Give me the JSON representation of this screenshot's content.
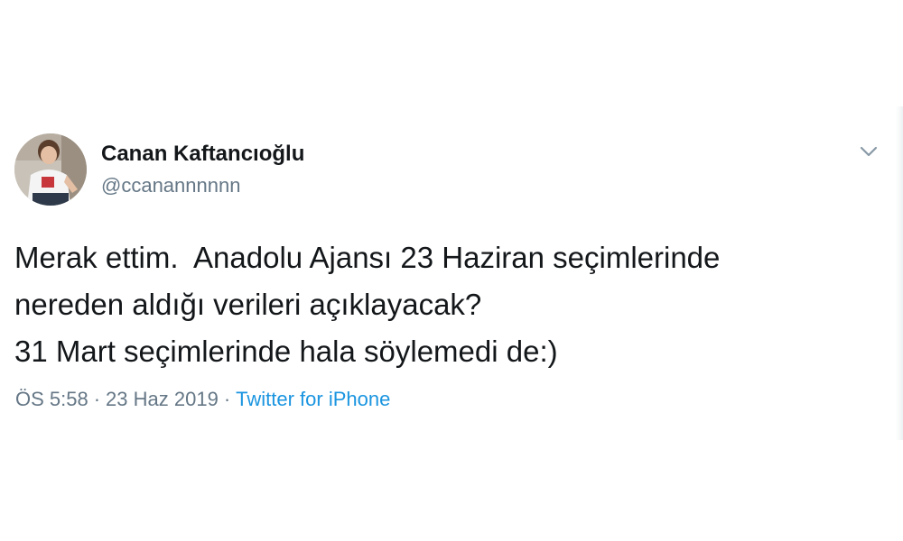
{
  "tweet": {
    "author": {
      "display_name": "Canan Kaftancıoğlu",
      "handle": "@ccanannnnnn"
    },
    "text_lines": [
      "Merak ettim.  Anadolu Ajansı 23 Haziran seçimlerinde",
      "nereden aldığı verileri açıklayacak?",
      "31 Mart seçimlerinde hala söylemedi de:)"
    ],
    "time": "ÖS 5:58",
    "date": "23 Haz 2019",
    "separator": "·",
    "source": "Twitter for iPhone",
    "menu_icon": "chevron-down-icon"
  },
  "colors": {
    "text": "#14171a",
    "secondary": "#657786",
    "link": "#1b95e0",
    "background": "#ffffff"
  }
}
